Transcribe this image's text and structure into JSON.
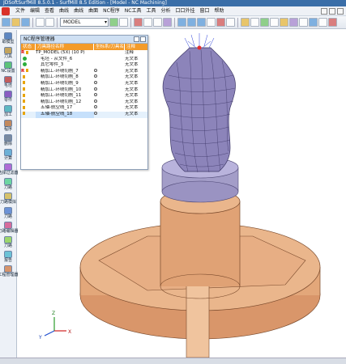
{
  "title_bar": {
    "text": "JDSoftSurfMill 8.5.0.1 - SurfMill 8.5 Edition - [Model - NC Machining]"
  },
  "menu": {
    "items": [
      "文件",
      "编辑",
      "查看",
      "曲线",
      "曲线",
      "曲面",
      "NC程序",
      "NC工具",
      "工具",
      "分析",
      "口口外挂",
      "窗口",
      "帮助"
    ]
  },
  "toolbar": {
    "model_select": "MODEL"
  },
  "sidebar": {
    "items": [
      "取模型",
      "刀具",
      "NC设置",
      "毛坯",
      "零件",
      "加工",
      "程序",
      "删除",
      "计算",
      "选择过滤器",
      "刀路",
      "刀路模拟",
      "刀路",
      "刀路编辑器",
      "刀路",
      "报告",
      "工程管理器"
    ]
  },
  "tree_window": {
    "title": "NC程序管理器",
    "columns": [
      "状态",
      "刀具路径名称",
      "坐标系/刀具名称",
      "注释"
    ],
    "rows": [
      {
        "status": "R",
        "name": "TP_MODEL (5X) (10 P)",
        "tool": "",
        "note": "注释"
      },
      {
        "status": "",
        "name": "毛坯 - 从文件_6",
        "tool": "",
        "note": "无文本"
      },
      {
        "status": "",
        "name": "其它零件_3",
        "tool": "",
        "note": "无文本"
      },
      {
        "status": "R",
        "name": "精加工-环绕切削_7",
        "tool": "",
        "note": "无文本"
      },
      {
        "status": "",
        "name": "精加工-环绕切削_8",
        "tool": "",
        "note": "无文本"
      },
      {
        "status": "",
        "name": "精加工-环绕切削_9",
        "tool": "",
        "note": "无文本"
      },
      {
        "status": "",
        "name": "精加工-环绕切削_10",
        "tool": "",
        "note": "无文本"
      },
      {
        "status": "",
        "name": "精加工-环绕切削_11",
        "tool": "",
        "note": "无文本"
      },
      {
        "status": "",
        "name": "精加工-环绕切削_12",
        "tool": "",
        "note": "无文本"
      },
      {
        "status": "",
        "name": "五轴-航空线_17",
        "tool": "",
        "note": "无文本"
      },
      {
        "status": "",
        "name": "五轴-航空线_18",
        "tool": "",
        "note": "无文本"
      }
    ]
  },
  "axes": {
    "x": "X",
    "y": "Y",
    "z": "Z"
  },
  "colors": {
    "accent": "#f39b2a",
    "stock": "#e0a47a",
    "model": "#8b84b8",
    "fixture": "#a9a4c8"
  }
}
